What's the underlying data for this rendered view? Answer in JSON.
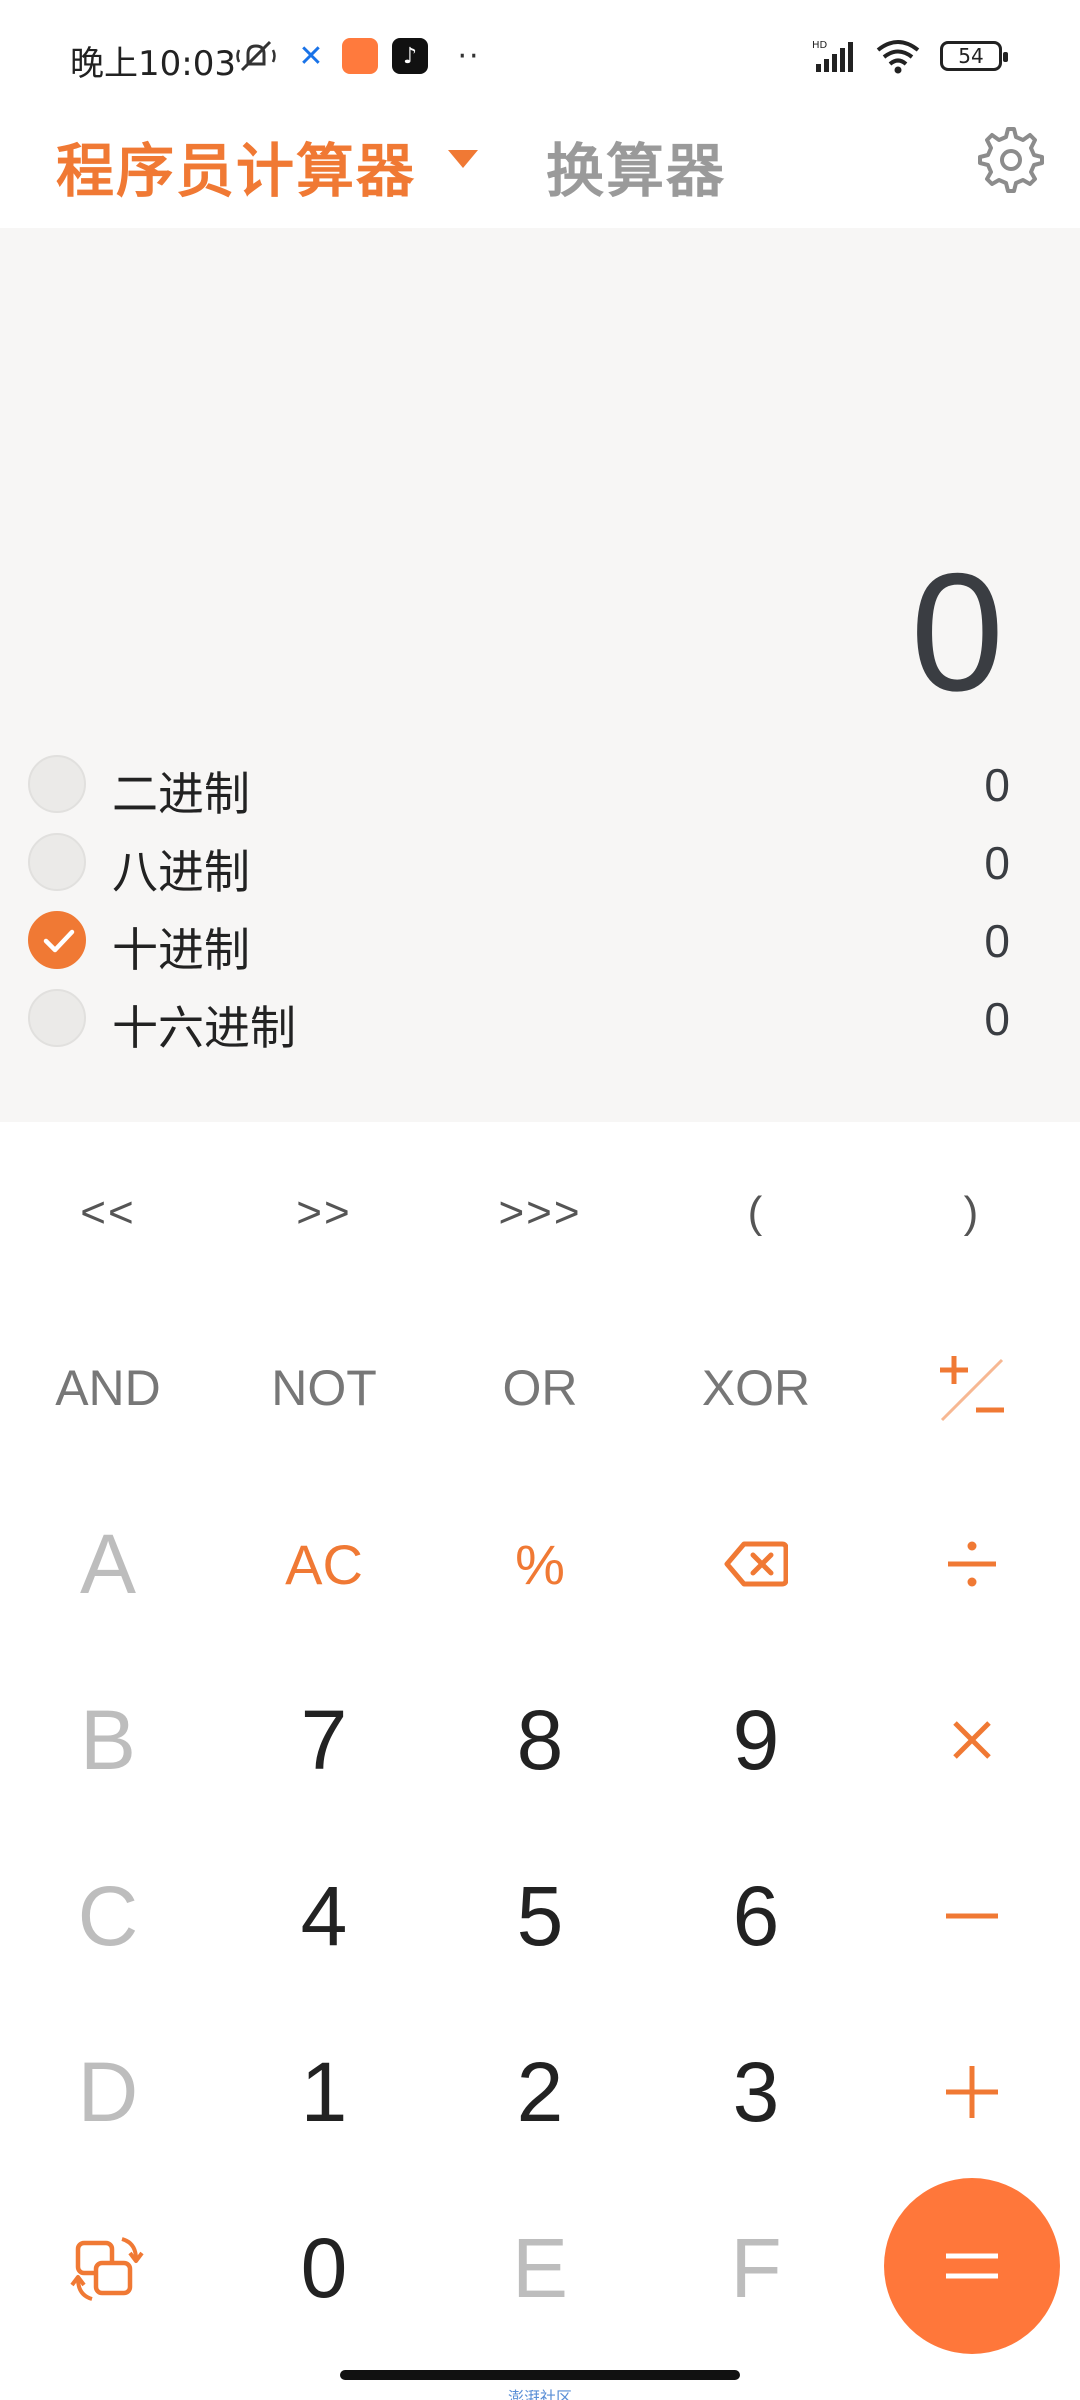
{
  "status_bar": {
    "time": "晚上10:03",
    "battery": "54",
    "signal_label": "HD"
  },
  "header": {
    "active_tab": "程序员计算器",
    "inactive_tab": "换算器"
  },
  "display": {
    "main_value": "0",
    "bases": [
      {
        "label": "二进制",
        "value": "0",
        "checked": false
      },
      {
        "label": "八进制",
        "value": "0",
        "checked": false
      },
      {
        "label": "十进制",
        "value": "0",
        "checked": true
      },
      {
        "label": "十六进制",
        "value": "0",
        "checked": false
      }
    ]
  },
  "keypad": {
    "shift_row": [
      "<<",
      ">>",
      ">>>",
      "(",
      ")"
    ],
    "logic_row": [
      "AND",
      "NOT",
      "OR",
      "XOR"
    ],
    "hex": [
      "A",
      "B",
      "C",
      "D",
      "E",
      "F"
    ],
    "ac": "AC",
    "percent": "%",
    "digits": [
      "7",
      "8",
      "9",
      "4",
      "5",
      "6",
      "1",
      "2",
      "3",
      "0"
    ]
  },
  "colors": {
    "accent": "#f07934",
    "display_bg": "#f7f6f5"
  },
  "watermark": "澎湃社区"
}
